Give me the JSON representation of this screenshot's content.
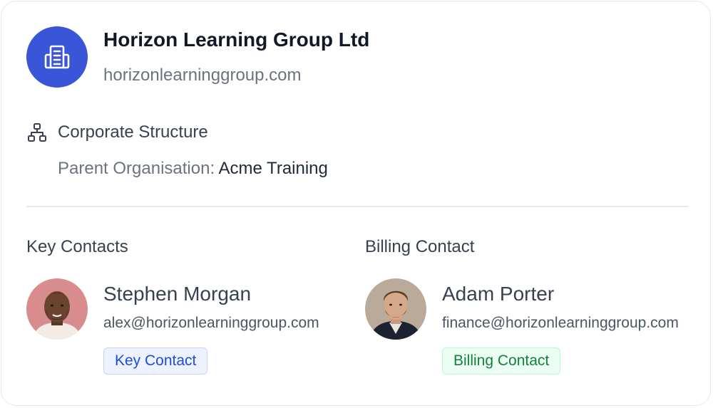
{
  "organisation": {
    "name": "Horizon Learning Group Ltd",
    "domain": "horizonlearninggroup.com",
    "icon": "building-icon",
    "accent_color": "#3b55d9"
  },
  "corporate_structure": {
    "title": "Corporate Structure",
    "icon": "org-chart-icon",
    "parent_label": "Parent Organisation:",
    "parent_value": "Acme Training"
  },
  "key_contacts": {
    "title": "Key Contacts",
    "contact": {
      "name": "Stephen Morgan",
      "email": "alex@horizonlearninggroup.com",
      "badge": "Key Contact",
      "badge_color": "#1d4ed8"
    }
  },
  "billing_contact": {
    "title": "Billing Contact",
    "contact": {
      "name": "Adam Porter",
      "email": "finance@horizonlearninggroup.com",
      "badge": "Billing Contact",
      "badge_color": "#15803d"
    }
  }
}
